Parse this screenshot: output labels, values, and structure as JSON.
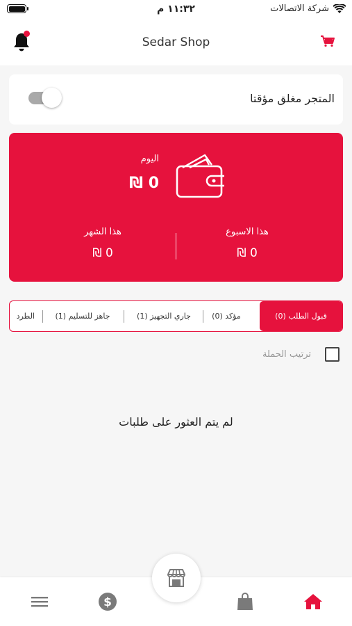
{
  "status_bar": {
    "carrier": "شركة الاتصالات",
    "time": "١١:٣٢ م"
  },
  "header": {
    "title": "Sedar Shop",
    "icons": [
      "bell-icon",
      "cart-icon"
    ],
    "notification_dot_color": "#e8123f"
  },
  "store_toggle": {
    "label": "المتجر مغلق مؤقتا",
    "state": "off"
  },
  "earnings": {
    "today_label": "اليوم",
    "today_value": "0 ₪",
    "week_label": "هذا الاسبوع",
    "week_value": "0 ₪",
    "month_label": "هذا الشهر",
    "month_value": "0 ₪",
    "accent_color": "#e6123d"
  },
  "tabs": [
    {
      "label": "قبول الطلب (0)",
      "active": true
    },
    {
      "label": "مؤكد (0)",
      "active": false
    },
    {
      "label": "جاري التجهيز (1)",
      "active": false
    },
    {
      "label": "جاهز للتسليم (1)",
      "active": false
    },
    {
      "label": "الطرد",
      "active": false
    }
  ],
  "sort": {
    "label": "ترتيب الحملة",
    "checked": false
  },
  "empty_message": "لم يتم العثور على طلبات",
  "bottom_nav": {
    "items": [
      "home-icon",
      "shopping-bag-icon",
      "store-icon",
      "dollar-icon",
      "menu-icon"
    ],
    "active": "home-icon"
  }
}
